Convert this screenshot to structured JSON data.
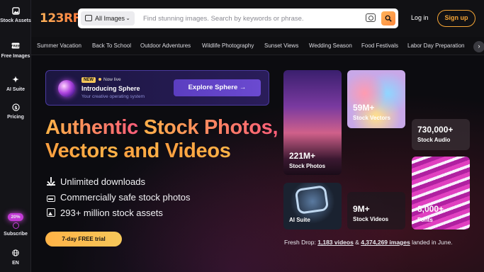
{
  "sidebar": {
    "items": [
      {
        "label": "Stock Assets",
        "icon": "image-icon"
      },
      {
        "label": "Free Images",
        "icon": "free-icon"
      },
      {
        "label": "AI Suite",
        "icon": "sparkle-icon"
      },
      {
        "label": "Pricing",
        "icon": "dollar-icon"
      }
    ],
    "subscribe": {
      "badge": "20%",
      "label": "Subscribe"
    },
    "language": {
      "label": "EN",
      "icon": "globe-icon"
    }
  },
  "header": {
    "logo": "123RF",
    "search_type": "All Images",
    "search_placeholder": "Find stunning images. Search by keywords or phrase.",
    "login": "Log in",
    "signup": "Sign up"
  },
  "categories": [
    "Summer Vacation",
    "Back To School",
    "Outdoor Adventures",
    "Wildlife Photography",
    "Sunset Views",
    "Wedding Season",
    "Food Festivals",
    "Labor Day Preparation"
  ],
  "promo": {
    "new_badge": "NEW",
    "now_live": "Now live",
    "title": "Introducing Sphere",
    "subtitle": "Your creative operating system",
    "button": "Explore Sphere →"
  },
  "hero": {
    "line1_grad": "Authentic",
    "line1_rest": " Stock Photos,",
    "line2_a": "Vectors",
    "line2_b": " and ",
    "line2_c": "Videos"
  },
  "features": [
    "Unlimited downloads",
    "Commercially safe stock photos",
    "293+ million stock assets"
  ],
  "trial_button": "7-day FREE trial",
  "tiles": [
    {
      "num": "221M+",
      "label": "Stock Photos"
    },
    {
      "num": "59M+",
      "label": "Stock Vectors"
    },
    {
      "num": "730,000+",
      "label": "Stock Audio"
    },
    {
      "num": "",
      "label": "AI Suite"
    },
    {
      "num": "9M+",
      "label": "Stock Videos"
    },
    {
      "num": "8,000+",
      "label": "Fonts"
    }
  ],
  "fresh": {
    "prefix": "Fresh Drop: ",
    "videos": "1,183 videos",
    "amp": " & ",
    "images": "4,374,269 images",
    "suffix": " landed in June."
  },
  "colors": {
    "accent": "#f5a536",
    "promo_bg": "#2a1d5a",
    "explore": "#6b4ad0"
  }
}
